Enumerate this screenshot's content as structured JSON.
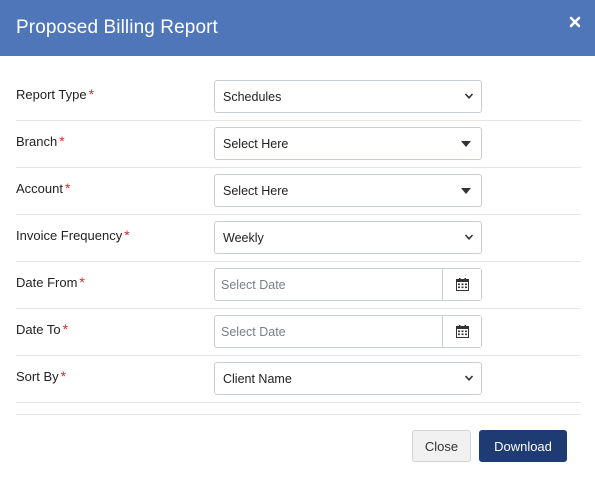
{
  "header": {
    "title": "Proposed Billing Report",
    "close_icon": "close-icon"
  },
  "required_marker": "*",
  "colors": {
    "header_bg": "#4f76b8",
    "primary_button": "#1f3b73",
    "required": "#d9272e"
  },
  "form": {
    "report_type": {
      "label": "Report Type",
      "value": "Schedules"
    },
    "branch": {
      "label": "Branch",
      "value": "Select Here"
    },
    "account": {
      "label": "Account",
      "value": "Select Here"
    },
    "invoice_frequency": {
      "label": "Invoice Frequency",
      "value": "Weekly"
    },
    "date_from": {
      "label": "Date From",
      "placeholder": "Select Date"
    },
    "date_to": {
      "label": "Date To",
      "placeholder": "Select Date"
    },
    "sort_by": {
      "label": "Sort By",
      "value": "Client Name"
    }
  },
  "footer": {
    "close_label": "Close",
    "download_label": "Download"
  }
}
